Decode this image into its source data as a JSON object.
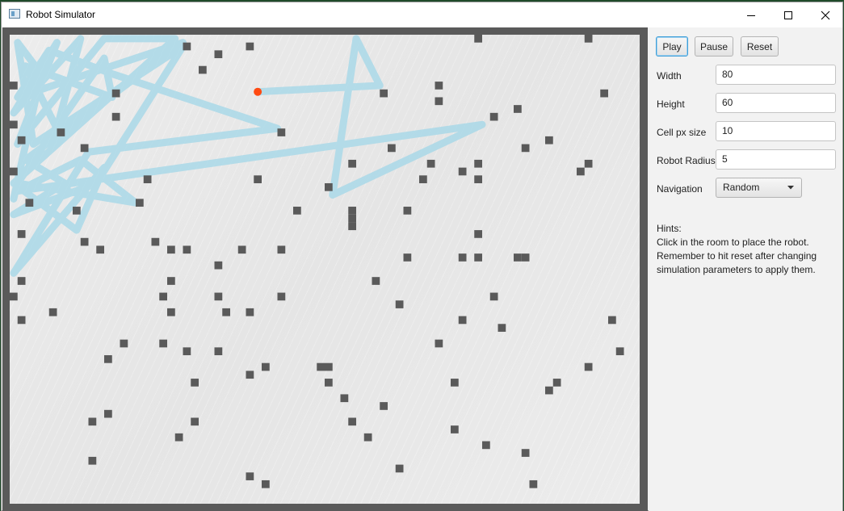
{
  "window": {
    "title": "Robot Simulator",
    "icon": "app-window-icon",
    "controls": [
      "minimize-icon",
      "maximize-icon",
      "close-icon"
    ]
  },
  "controls": {
    "play_label": "Play",
    "pause_label": "Pause",
    "reset_label": "Reset"
  },
  "settings": {
    "width_label": "Width",
    "width_value": "80",
    "height_label": "Height",
    "height_value": "60",
    "cell_label": "Cell px size",
    "cell_value": "10",
    "radius_label": "Robot Radius",
    "radius_value": "5",
    "navigation_label": "Navigation",
    "navigation_value": "Random"
  },
  "hints": {
    "title": "Hints:",
    "line1": "Click in the room to place the robot.",
    "line2": "Remember to hit reset after changing",
    "line3": "simulation parameters to apply them."
  },
  "colors": {
    "robot": "#ff4a12",
    "trail": "#a9d8e8",
    "obstacle": "#5a5a5a",
    "wall": "#5a5a5a"
  },
  "room": {
    "grid_cols": 80,
    "grid_rows": 60,
    "obstacles": [
      [
        59,
        0
      ],
      [
        73,
        0
      ],
      [
        22,
        1
      ],
      [
        30,
        1
      ],
      [
        26,
        2
      ],
      [
        24,
        4
      ],
      [
        0,
        6
      ],
      [
        54,
        6
      ],
      [
        13,
        7
      ],
      [
        47,
        7
      ],
      [
        54,
        8
      ],
      [
        75,
        7
      ],
      [
        13,
        10
      ],
      [
        64,
        9
      ],
      [
        61,
        10
      ],
      [
        0,
        11
      ],
      [
        6,
        12
      ],
      [
        34,
        12
      ],
      [
        1,
        13
      ],
      [
        68,
        13
      ],
      [
        9,
        14
      ],
      [
        48,
        14
      ],
      [
        65,
        14
      ],
      [
        43,
        16
      ],
      [
        53,
        16
      ],
      [
        59,
        16
      ],
      [
        0,
        17
      ],
      [
        57,
        17
      ],
      [
        72,
        17
      ],
      [
        73,
        16
      ],
      [
        17,
        18
      ],
      [
        31,
        18
      ],
      [
        52,
        18
      ],
      [
        59,
        18
      ],
      [
        40,
        19
      ],
      [
        2,
        21
      ],
      [
        16,
        21
      ],
      [
        8,
        22
      ],
      [
        36,
        22
      ],
      [
        43,
        22
      ],
      [
        43,
        23
      ],
      [
        43,
        24
      ],
      [
        50,
        22
      ],
      [
        1,
        25
      ],
      [
        59,
        25
      ],
      [
        9,
        26
      ],
      [
        18,
        26
      ],
      [
        11,
        27
      ],
      [
        20,
        27
      ],
      [
        22,
        27
      ],
      [
        29,
        27
      ],
      [
        34,
        27
      ],
      [
        50,
        28
      ],
      [
        57,
        28
      ],
      [
        59,
        28
      ],
      [
        64,
        28
      ],
      [
        65,
        28
      ],
      [
        26,
        29
      ],
      [
        1,
        31
      ],
      [
        20,
        31
      ],
      [
        46,
        31
      ],
      [
        0,
        33
      ],
      [
        19,
        33
      ],
      [
        26,
        33
      ],
      [
        34,
        33
      ],
      [
        61,
        33
      ],
      [
        49,
        34
      ],
      [
        5,
        35
      ],
      [
        1,
        36
      ],
      [
        20,
        35
      ],
      [
        27,
        35
      ],
      [
        30,
        35
      ],
      [
        57,
        36
      ],
      [
        62,
        37
      ],
      [
        76,
        36
      ],
      [
        14,
        39
      ],
      [
        19,
        39
      ],
      [
        54,
        39
      ],
      [
        22,
        40
      ],
      [
        26,
        40
      ],
      [
        77,
        40
      ],
      [
        12,
        41
      ],
      [
        32,
        42
      ],
      [
        39,
        42
      ],
      [
        40,
        42
      ],
      [
        73,
        42
      ],
      [
        30,
        43
      ],
      [
        23,
        44
      ],
      [
        40,
        44
      ],
      [
        56,
        44
      ],
      [
        69,
        44
      ],
      [
        68,
        45
      ],
      [
        42,
        46
      ],
      [
        47,
        47
      ],
      [
        12,
        48
      ],
      [
        10,
        49
      ],
      [
        23,
        49
      ],
      [
        43,
        49
      ],
      [
        56,
        50
      ],
      [
        21,
        51
      ],
      [
        45,
        51
      ],
      [
        60,
        52
      ],
      [
        65,
        53
      ],
      [
        10,
        54
      ],
      [
        49,
        55
      ],
      [
        30,
        56
      ],
      [
        32,
        57
      ],
      [
        66,
        57
      ]
    ],
    "robot": {
      "col": 31.5,
      "row": 7.3
    },
    "trail": [
      [
        31.5,
        7.3
      ],
      [
        47,
        6.5
      ],
      [
        44,
        0.5
      ],
      [
        41,
        20.5
      ],
      [
        60,
        11.5
      ],
      [
        1,
        20
      ],
      [
        9,
        16
      ],
      [
        16,
        21.5
      ],
      [
        1,
        19
      ],
      [
        12,
        3
      ],
      [
        13,
        8
      ],
      [
        2,
        4
      ],
      [
        6,
        12
      ],
      [
        9,
        0.5
      ],
      [
        0.5,
        10
      ],
      [
        6,
        1
      ],
      [
        1,
        14
      ],
      [
        12,
        0.5
      ],
      [
        21,
        0.5
      ],
      [
        0.5,
        19
      ],
      [
        8.5,
        25
      ],
      [
        12,
        17
      ],
      [
        0.5,
        30.5
      ],
      [
        10,
        15
      ],
      [
        34,
        12
      ],
      [
        13,
        5
      ],
      [
        5,
        2
      ],
      [
        1,
        8
      ],
      [
        22,
        1
      ],
      [
        2,
        16
      ],
      [
        7,
        19
      ],
      [
        0.5,
        23
      ],
      [
        11,
        19
      ],
      [
        22,
        1.5
      ],
      [
        3,
        14
      ],
      [
        1,
        1
      ],
      [
        4,
        5
      ],
      [
        0.5,
        21
      ]
    ]
  }
}
